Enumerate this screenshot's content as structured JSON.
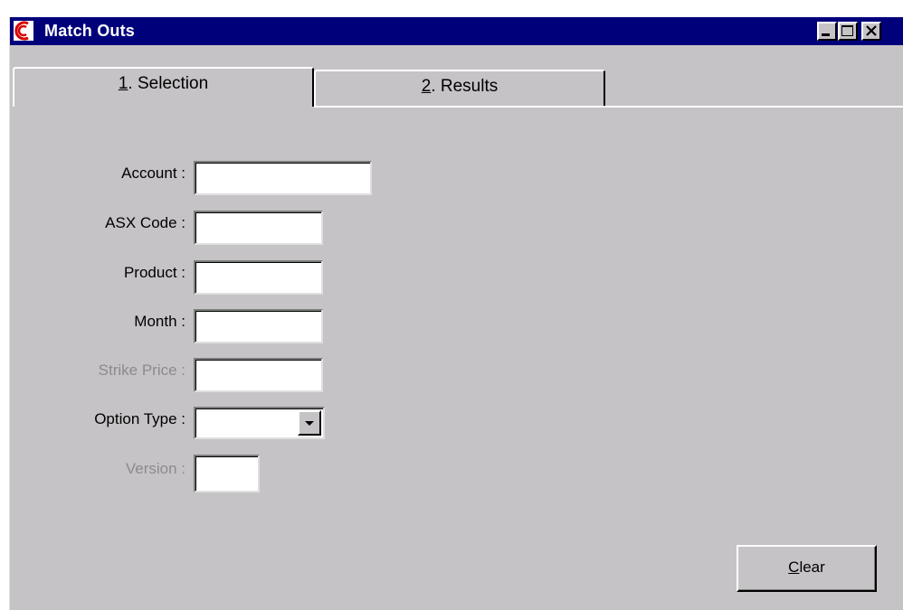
{
  "window": {
    "title": "Match Outs"
  },
  "tabs": [
    {
      "mnemonic": "1",
      "label": ". Selection",
      "active": true
    },
    {
      "mnemonic": "2",
      "label": ". Results",
      "active": false
    }
  ],
  "form": {
    "account_label": "Account :",
    "account_value": "",
    "asx_code_label": "ASX Code :",
    "asx_code_value": "",
    "product_label": "Product :",
    "product_value": "",
    "month_label": "Month :",
    "month_value": "",
    "strike_price_label": "Strike Price :",
    "strike_price_value": "",
    "option_type_label": "Option Type :",
    "option_type_value": "",
    "version_label": "Version :",
    "version_value": ""
  },
  "buttons": {
    "clear_mnemonic": "C",
    "clear_rest": "lear"
  },
  "colors": {
    "titlebar": "#00007b",
    "face": "#c6c3c6",
    "disabled_text": "#8c8a8c",
    "logo_red": "#d60000"
  },
  "icons": {
    "app": "app-logo-icon",
    "minimize": "minimize-icon",
    "maximize": "maximize-icon",
    "close": "close-icon",
    "dropdown": "chevron-down-icon"
  }
}
